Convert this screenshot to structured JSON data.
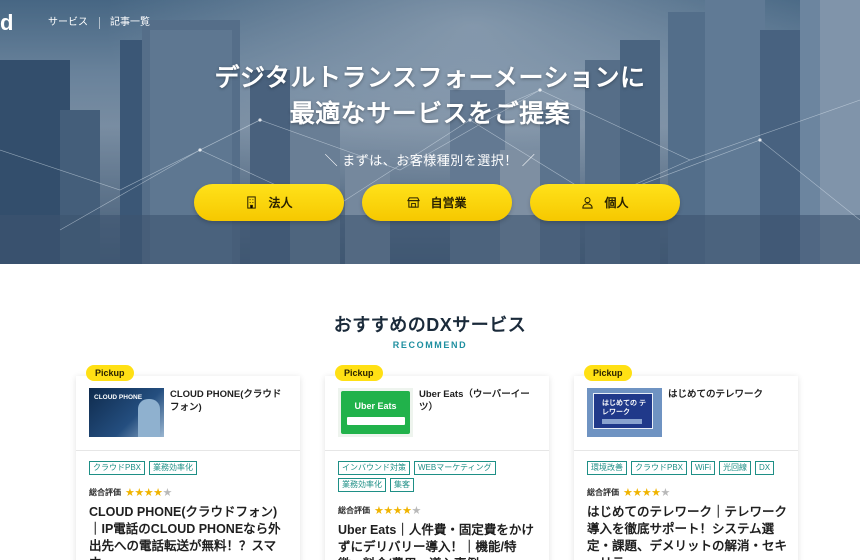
{
  "nav": {
    "items": [
      "サービス",
      "記事一覧"
    ]
  },
  "hero": {
    "title_line1": "デジタルトランスフォーメーションに",
    "title_line2": "最適なサービスをご提案",
    "subtitle": "＼ まずは、お客様種別を選択！ ／",
    "buttons": [
      {
        "label": "法人",
        "icon": "building-icon"
      },
      {
        "label": "自営業",
        "icon": "shop-icon"
      },
      {
        "label": "個人",
        "icon": "person-icon"
      }
    ]
  },
  "section": {
    "title": "おすすめのDXサービス",
    "subtitle": "RECOMMEND"
  },
  "cards": [
    {
      "badge": "Pickup",
      "name": "CLOUD PHONE(クラウドフォン)",
      "thumb_title": "CLOUD PHONE",
      "tags": [
        "クラウドPBX",
        "業務効率化"
      ],
      "rating_label": "総合評価",
      "rating": 4,
      "desc": "CLOUD PHONE(クラウドフォン)｜IP電話のCLOUD PHONEなら外出先への電話転送が無料！？スマホ…"
    },
    {
      "badge": "Pickup",
      "name": "Uber Eats（ウーバーイーツ）",
      "thumb_title": "Uber Eats",
      "tags": [
        "インバウンド対策",
        "WEBマーケティング",
        "業務効率化",
        "集客"
      ],
      "rating_label": "総合評価",
      "rating": 4,
      "desc": "Uber Eats｜人件費・固定費をかけずにデリバリー導入！｜機能/特徴・料金/費用・導入事例"
    },
    {
      "badge": "Pickup",
      "name": "はじめてのテレワーク",
      "thumb_title": "はじめての テレワーク",
      "tags": [
        "環境改善",
        "クラウドPBX",
        "WiFi",
        "光回線",
        "DX"
      ],
      "rating_label": "総合評価",
      "rating": 4,
      "desc": "はじめてのテレワーク｜テレワーク導入を徹底サポート！システム選定・課題、デメリットの解消・セキュリテ…"
    }
  ]
}
